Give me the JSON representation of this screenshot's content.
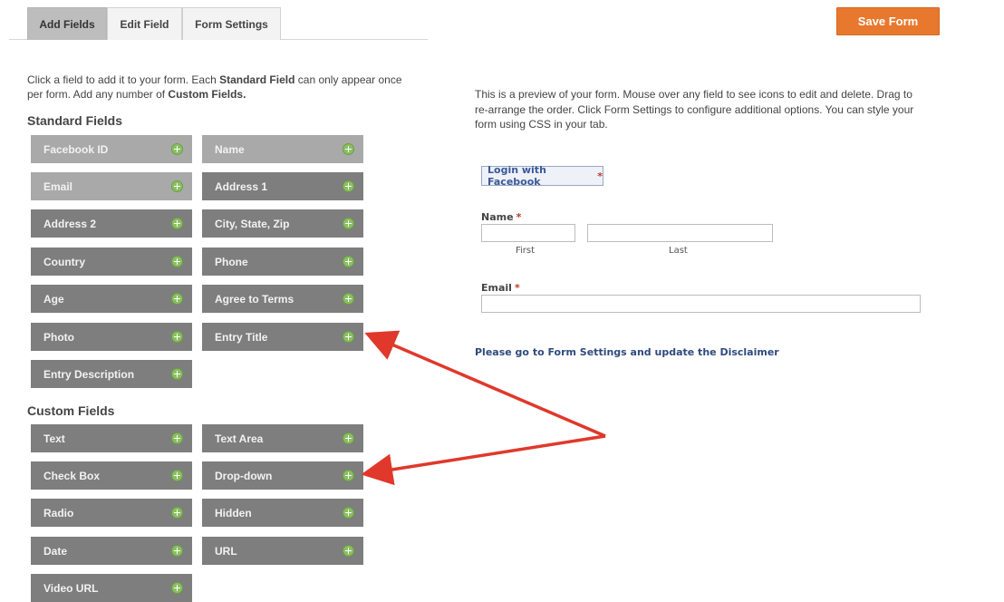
{
  "tabs": [
    {
      "label": "Add Fields",
      "active": true
    },
    {
      "label": "Edit Field",
      "active": false
    },
    {
      "label": "Form Settings",
      "active": false
    }
  ],
  "save_button": "Save Form",
  "intro": {
    "part1": "Click a field to add it to your form. Each ",
    "bold1": "Standard Field",
    "part2": " can only appear once per form. Add any number of ",
    "bold2": "Custom Fields."
  },
  "standard_fields": {
    "title": "Standard Fields",
    "items": [
      "Facebook ID",
      "Name",
      "Email",
      "Address 1",
      "Address 2",
      "City, State, Zip",
      "Country",
      "Phone",
      "Age",
      "Agree to Terms",
      "Photo",
      "Entry Title",
      "Entry Description"
    ],
    "disabled": [
      "Facebook ID",
      "Email"
    ]
  },
  "custom_fields": {
    "title": "Custom Fields",
    "items": [
      "Text",
      "Text Area",
      "Check Box",
      "Drop-down",
      "Radio",
      "Hidden",
      "Date",
      "URL",
      "Video URL"
    ]
  },
  "preview": {
    "description": "This is a preview of your form. Mouse over any field to see icons to edit and delete. Drag to re-arrange the order. Click Form Settings to configure additional options. You can style your form using CSS in your tab.",
    "facebook_login": "Login with Facebook",
    "required_mark": "*",
    "name_label": "Name",
    "first_label": "First",
    "last_label": "Last",
    "first_value": "",
    "last_value": "",
    "email_label": "Email",
    "email_value": "",
    "disclaimer": "Please go to Form Settings and update the Disclaimer"
  },
  "colors": {
    "accent": "#e8782e",
    "field_bg": "#7e7e7e",
    "field_disabled_bg": "#a9a9a9",
    "plus_green": "#8bbf62",
    "arrow_red": "#e0382b",
    "link_blue": "#2f4a7d"
  }
}
